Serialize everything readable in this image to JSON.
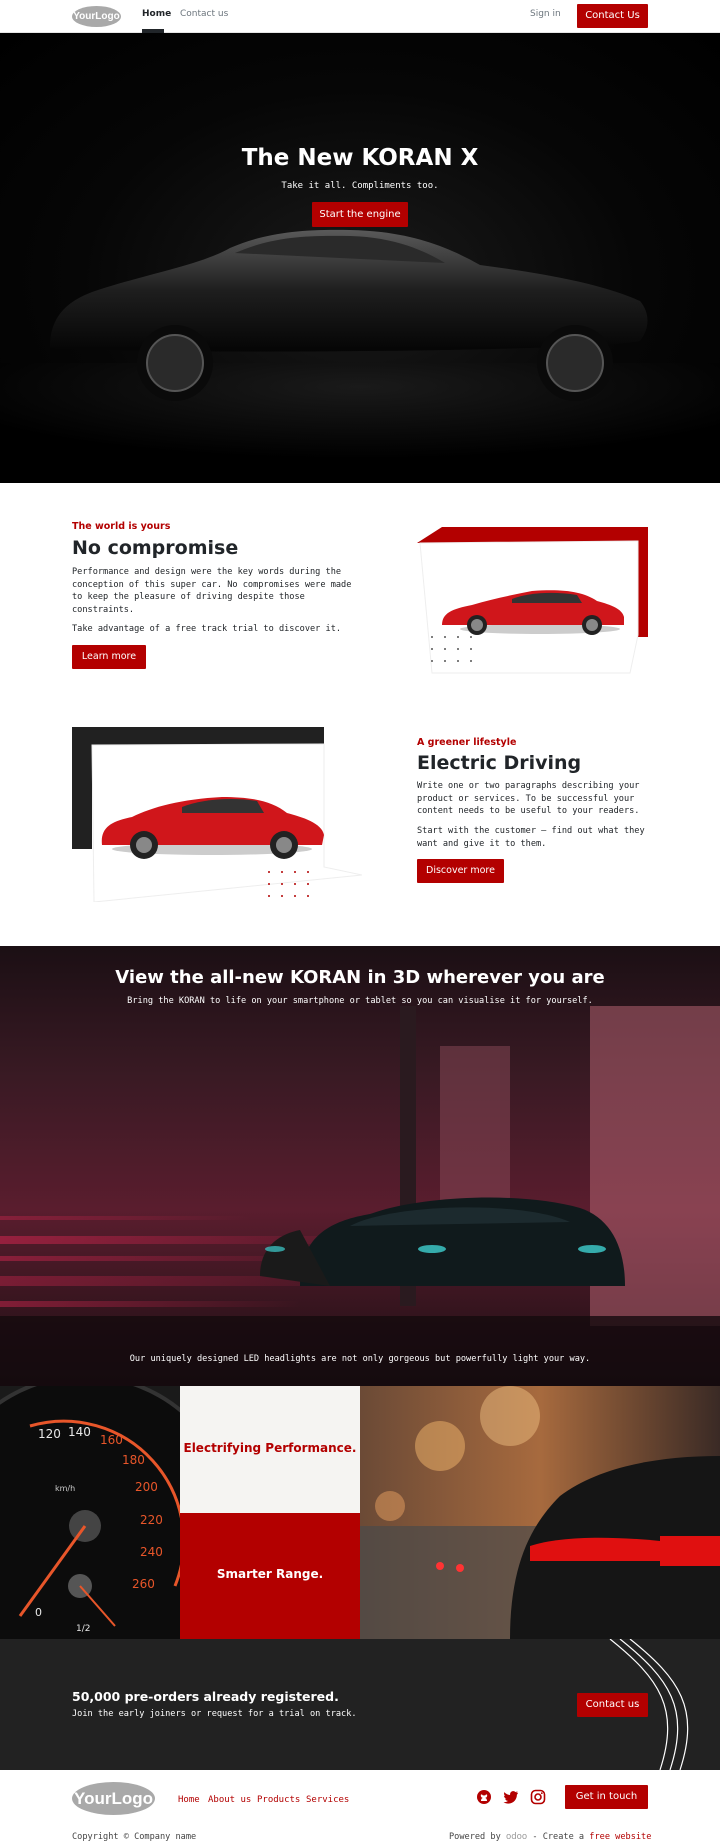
{
  "nav": {
    "logo": "YourLogo",
    "links": [
      "Home",
      "Contact us"
    ],
    "signin": "Sign in",
    "cta": "Contact Us"
  },
  "hero": {
    "title": "The New KORAN X",
    "subtitle": "Take it all. Compliments too.",
    "cta": "Start the engine"
  },
  "feature1": {
    "eyebrow": "The world is yours",
    "title": "No compromise",
    "para1": "Performance and design were the key words during the conception of this super car. No compromises were made to keep the pleasure of driving despite those constraints.",
    "para2": "Take advantage of a free track trial to discover it.",
    "cta": "Learn more"
  },
  "feature2": {
    "eyebrow": "A greener lifestyle",
    "title": "Electric Driving",
    "para1": "Write one or two paragraphs describing your product or services. To be successful your content needs to be useful to your readers.",
    "para2": "Start with the customer – find out what they want and give it to them.",
    "cta": "Discover more"
  },
  "banner3d": {
    "title": "View the all-new KORAN in 3D wherever you are",
    "subtitle": "Bring the KORAN to life on your smartphone or tablet so you can visualise it for yourself.",
    "caption": "Our uniquely designed LED headlights are not only gorgeous but powerfully light your way."
  },
  "grid": {
    "top": "Electrifying Performance.",
    "bottom": "Smarter Range.",
    "speedo_labels": [
      "120",
      "140",
      "160",
      "180",
      "200",
      "220",
      "240",
      "260",
      "km/h",
      "0",
      "1/2"
    ]
  },
  "preorders": {
    "title": "50,000 pre-orders already registered.",
    "text": "Join the early joiners or request for a trial on track.",
    "cta": "Contact us"
  },
  "footer": {
    "logo": "YourLogo",
    "links": [
      "Home",
      "About us",
      "Products",
      "Services"
    ],
    "cta": "Get in touch",
    "copyright": "Copyright © Company name",
    "powered_prefix": "Powered by",
    "powered_brand": "odoo",
    "powered_mid": "- Create a",
    "powered_link": "free website"
  },
  "colors": {
    "accent": "#b30000",
    "dark": "#222222",
    "light_cell": "#f5f4f2"
  },
  "icons": [
    "github-icon",
    "twitter-icon",
    "instagram-icon"
  ]
}
